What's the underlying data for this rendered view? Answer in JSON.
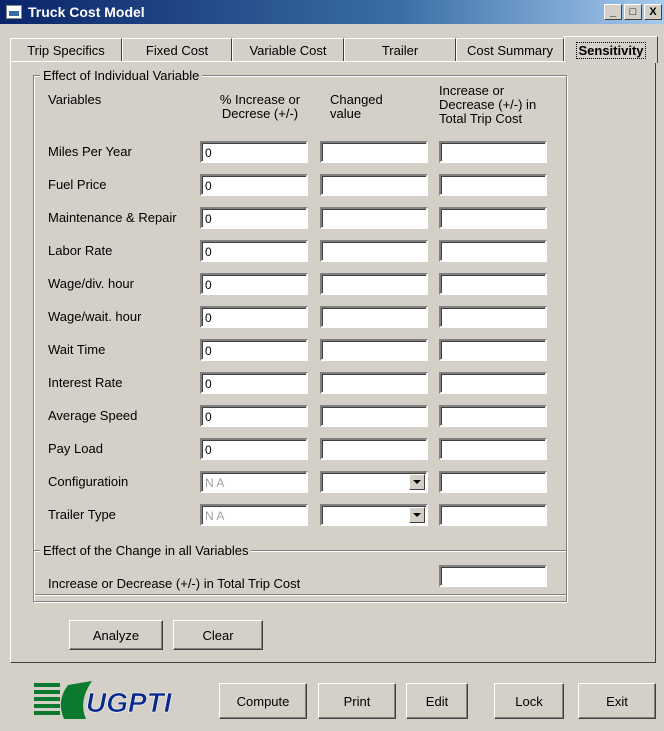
{
  "window": {
    "title": "Truck Cost Model"
  },
  "titlebar_buttons": {
    "minimize": "_",
    "maximize": "□",
    "close": "X"
  },
  "tabs": [
    {
      "label": "Trip Specifics"
    },
    {
      "label": "Fixed Cost"
    },
    {
      "label": "Variable Cost"
    },
    {
      "label": "Trailer"
    },
    {
      "label": "Cost Summary"
    },
    {
      "label": "Sensitivity"
    }
  ],
  "active_tab": "Sensitivity",
  "individual": {
    "legend": "Effect of Individual Variable",
    "headers": {
      "variables": "Variables",
      "pct_line1": "% Increase or",
      "pct_line2": "Decrese (+/-)",
      "changed_line1": "Changed",
      "changed_line2": "value",
      "total_line1": "Increase or",
      "total_line2": "Decrease (+/-) in",
      "total_line3": "Total Trip Cost"
    },
    "rows": [
      {
        "label": "Miles Per Year",
        "pct": "0",
        "changed": "",
        "total": ""
      },
      {
        "label": "Fuel Price",
        "pct": "0",
        "changed": "",
        "total": ""
      },
      {
        "label": "Maintenance & Repair",
        "pct": "0",
        "changed": "",
        "total": ""
      },
      {
        "label": "Labor Rate",
        "pct": "0",
        "changed": "",
        "total": ""
      },
      {
        "label": "Wage/div. hour",
        "pct": "0",
        "changed": "",
        "total": ""
      },
      {
        "label": "Wage/wait. hour",
        "pct": "0",
        "changed": "",
        "total": ""
      },
      {
        "label": "Wait Time",
        "pct": "0",
        "changed": "",
        "total": ""
      },
      {
        "label": "Interest Rate",
        "pct": "0",
        "changed": "",
        "total": ""
      },
      {
        "label": "Average Speed",
        "pct": "0",
        "changed": "",
        "total": ""
      },
      {
        "label": "Pay Load",
        "pct": "0",
        "changed": "",
        "total": ""
      },
      {
        "label": "Configuratioin",
        "pct": "N A",
        "changed": "",
        "total": ""
      },
      {
        "label": "Trailer Type",
        "pct": "N A",
        "changed": "",
        "total": ""
      }
    ]
  },
  "all_vars": {
    "legend": "Effect of the Change in all Variables",
    "label": "Increase or Decrease (+/-) in Total Trip Cost",
    "value": ""
  },
  "actions": {
    "analyze": "Analyze",
    "clear": "Clear"
  },
  "bottom": {
    "logo_text": "UGPTI",
    "compute": "Compute",
    "print": "Print",
    "edit": "Edit",
    "lock": "Lock",
    "exit": "Exit"
  },
  "colors": {
    "face": "#d4d0c8",
    "title_start": "#0a246a",
    "title_end": "#a6caf0",
    "logo_green": "#0b7a2e",
    "logo_blue": "#0a2a8a"
  }
}
